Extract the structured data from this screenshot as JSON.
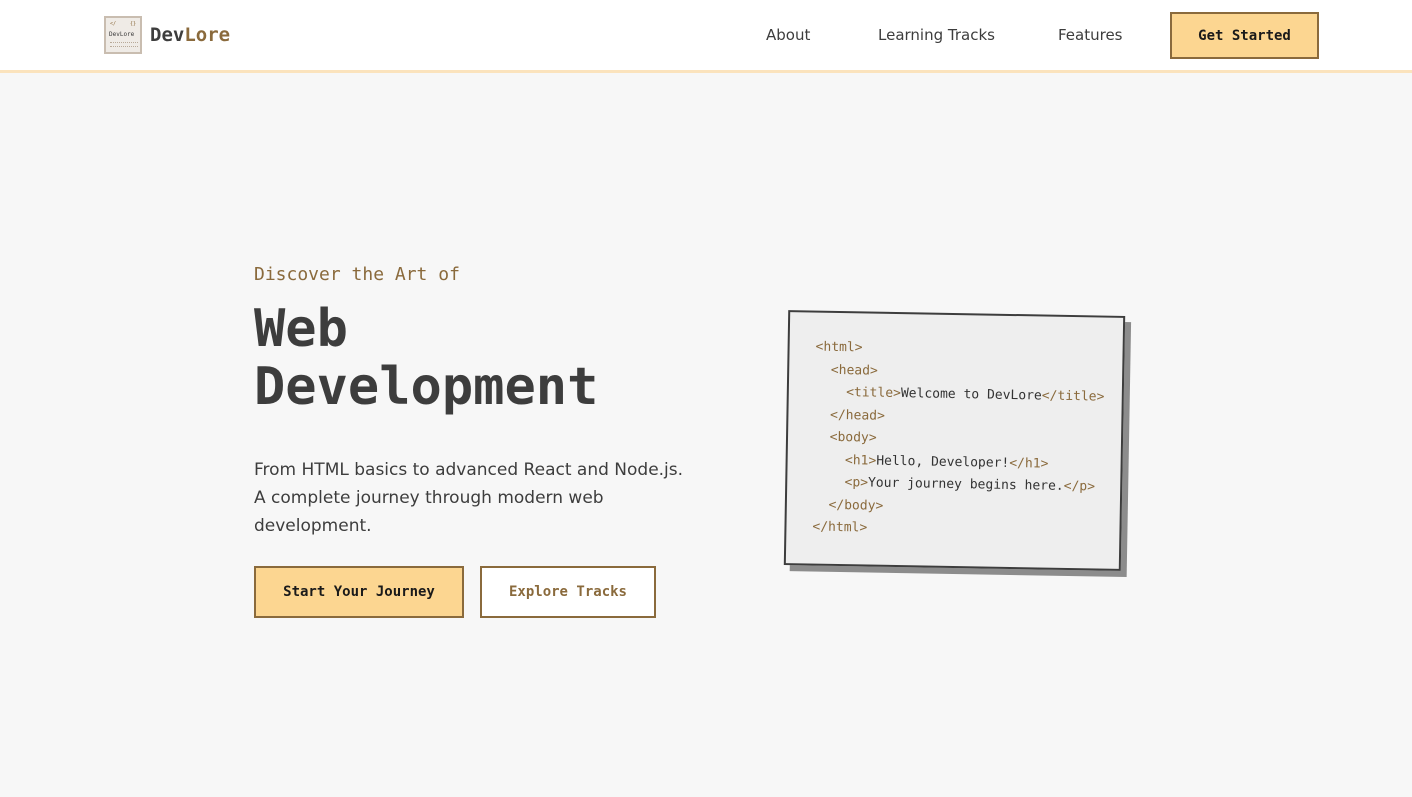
{
  "brand": {
    "name_prefix": "Dev",
    "name_suffix": "Lore",
    "logo_mark_text": "DevLore"
  },
  "nav": {
    "links": [
      "About",
      "Learning Tracks",
      "Features"
    ],
    "cta_label": "Get Started"
  },
  "hero": {
    "eyebrow": "Discover the Art of",
    "headline_line1": "Web",
    "headline_line2": "Development",
    "description": "From HTML basics to advanced React and Node.js. A complete journey through modern web development.",
    "primary_button": "Start Your Journey",
    "secondary_button": "Explore Tracks"
  },
  "code_sample": {
    "lines": [
      {
        "indent": "",
        "open": "<html>",
        "text": "",
        "close": ""
      },
      {
        "indent": "  ",
        "open": "<head>",
        "text": "",
        "close": ""
      },
      {
        "indent": "    ",
        "open": "<title>",
        "text": "Welcome to DevLore",
        "close": "</title>"
      },
      {
        "indent": "  ",
        "open": "</head>",
        "text": "",
        "close": ""
      },
      {
        "indent": "  ",
        "open": "<body>",
        "text": "",
        "close": ""
      },
      {
        "indent": "    ",
        "open": "<h1>",
        "text": "Hello, Developer!",
        "close": "</h1>"
      },
      {
        "indent": "    ",
        "open": "<p>",
        "text": "Your journey begins here.",
        "close": "</p>"
      },
      {
        "indent": "  ",
        "open": "</body>",
        "text": "",
        "close": ""
      },
      {
        "indent": "",
        "open": "</html>",
        "text": "",
        "close": ""
      }
    ]
  },
  "colors": {
    "accent": "#8a6a3c",
    "button_fill": "#fcd691",
    "background": "#f7f7f7",
    "text": "#3d3d3d"
  }
}
